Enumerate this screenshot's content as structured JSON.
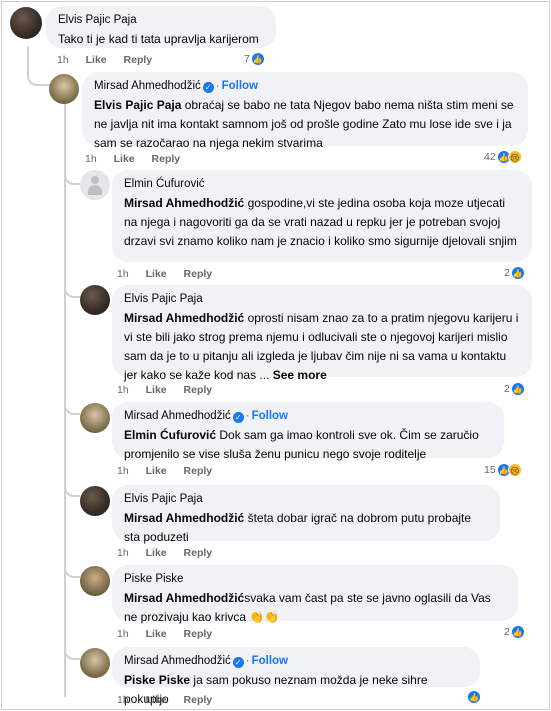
{
  "colors": {
    "accent": "#1877f2",
    "bubble": "#f0f2f5",
    "meta": "#65676b"
  },
  "actions": {
    "like": "Like",
    "reply": "Reply",
    "follow": "Follow",
    "see_more": "See more"
  },
  "comments": [
    {
      "author": "Elvis Pajic Paja",
      "text": "Tako ti je kad ti tata upravlja karijerom",
      "time": "1h",
      "reactions": "7",
      "icon": "like-icon"
    },
    {
      "author": "Mirsad Ahmedhodžić",
      "verified": true,
      "mention": "Elvis Pajic Paja",
      "text": " obraćaj se babo ne tata Njegov babo nema ništa stim meni se ne javlja nit ima kontakt samnom još od prošle godine Zato mu lose ide sve i ja sam se razočarao na njega nekim stvarima",
      "time": "1h",
      "reactions": "42",
      "icon": "like-icon",
      "icon2": "sad-icon"
    },
    {
      "author": "Elmin Ćufurović",
      "mention": "Mirsad Ahmedhodžić",
      "text": " gospodine,vi ste jedina osoba koja moze utjecati na njega i nagovoriti ga da se vrati nazad u repku jer je potreban svojoj drzavi svi znamo koliko nam je znacio i koliko smo sigurnije djelovali snjim",
      "time": "1h",
      "reactions": "2",
      "icon": "like-icon"
    },
    {
      "author": "Elvis Pajic Paja",
      "mention": "Mirsad Ahmedhodžić",
      "text": " oprosti nisam znao za to a pratim njegovu karijeru i vi ste bili jako strog prema njemu i odlucivali ste o njegovoj karijeri mislio sam da je to u pitanju ali izgleda je ljubav čim nije ni sa vama u kontaktu jer kako se kaže kod nas ... ",
      "time": "1h",
      "reactions": "2",
      "icon": "like-icon"
    },
    {
      "author": "Mirsad Ahmedhodžić",
      "verified": true,
      "mention": "Elmin Ćufurović",
      "text": " Dok sam ga imao kontroli sve ok. Čim se zaručio promjenilo se vise sluša ženu punicu nego svoje roditelje",
      "time": "1h",
      "reactions": "15",
      "icon": "like-icon",
      "icon2": "sad-icon"
    },
    {
      "author": "Elvis Pajic Paja",
      "mention": "Mirsad Ahmedhodžić",
      "text": " šteta dobar igrač na dobrom putu probajte sta poduzeti",
      "time": "1h"
    },
    {
      "author": "Piske Piske",
      "mention": "Mirsad Ahmedhodžić",
      "text": "svaka vam čast pa ste se javno oglasili da Vas ne prozivaju kao krivca 👏👏",
      "time": "1h",
      "reactions": "2",
      "icon": "like-icon"
    },
    {
      "author": "Mirsad Ahmedhodžić",
      "verified": true,
      "mention": "Piske Piske",
      "text": " ja sam pokuso neznam možda je neke sihre pokupijo",
      "time": "1h",
      "icon": "like-icon"
    }
  ]
}
